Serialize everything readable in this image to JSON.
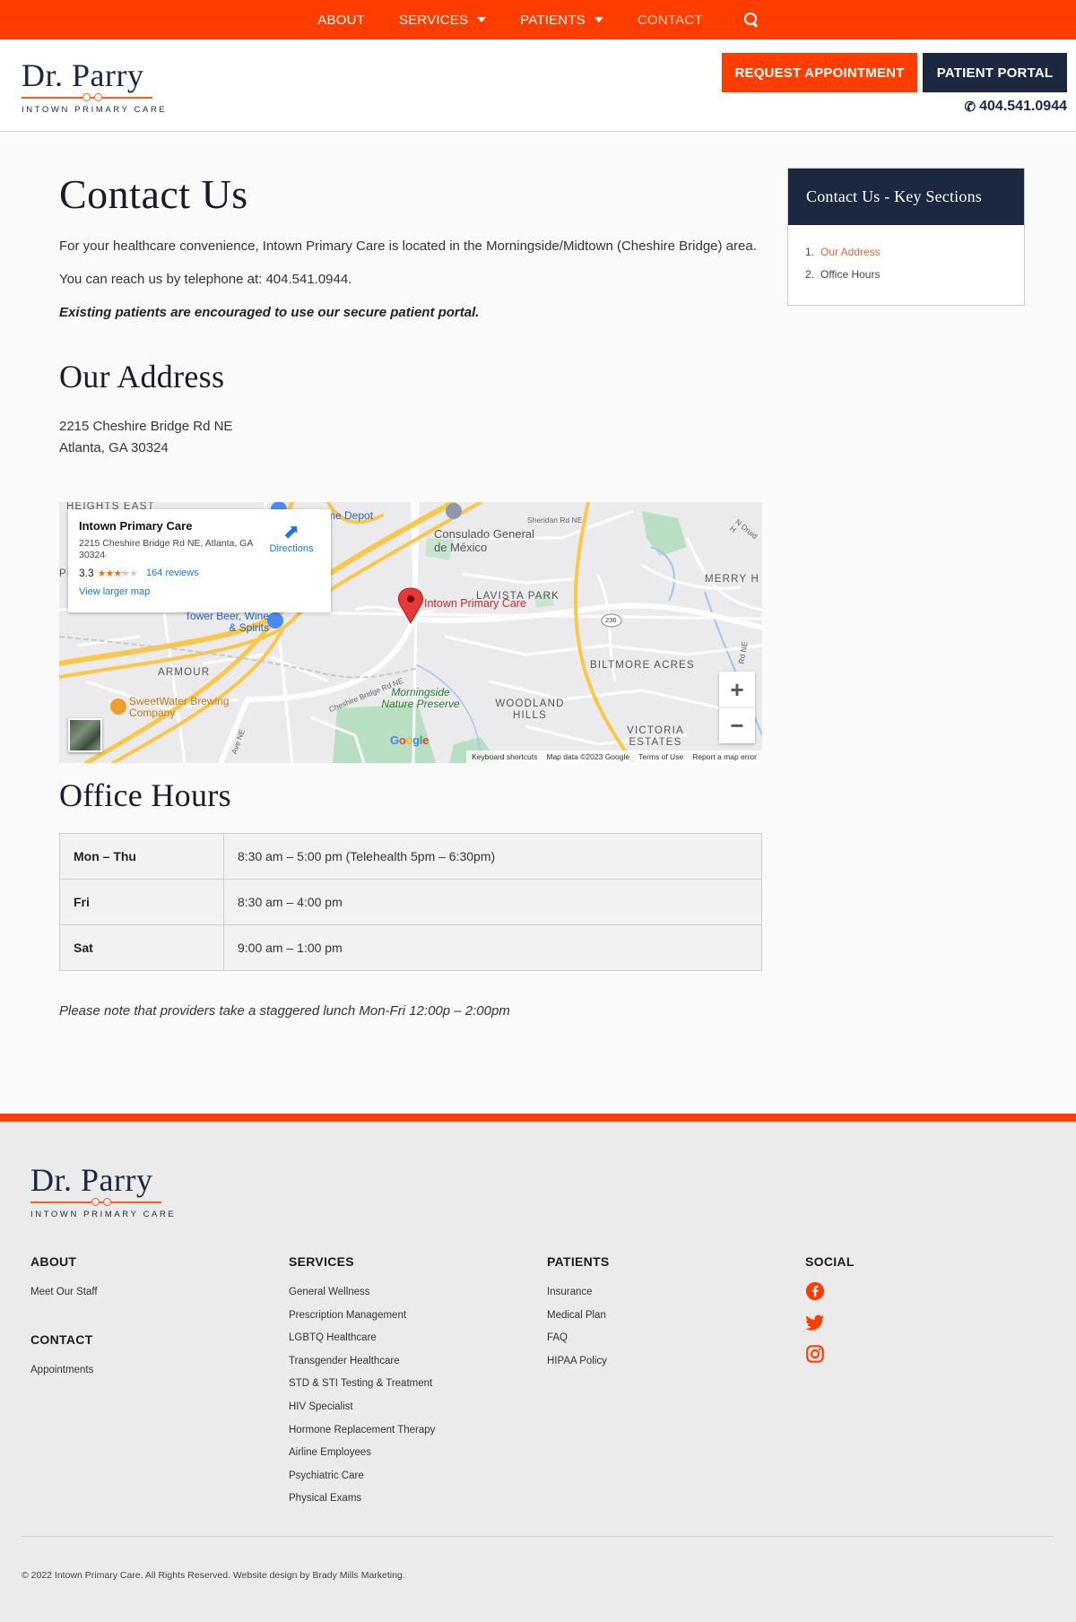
{
  "nav": {
    "items": [
      {
        "label": "ABOUT",
        "dropdown": false,
        "active": false
      },
      {
        "label": "SERVICES",
        "dropdown": true,
        "active": false
      },
      {
        "label": "PATIENTS",
        "dropdown": true,
        "active": false
      },
      {
        "label": "CONTACT",
        "dropdown": false,
        "active": true
      }
    ],
    "search_icon": "search-icon"
  },
  "brand": {
    "name": "Dr. Parry",
    "tagline": "INTOWN PRIMARY CARE",
    "colors": {
      "accent": "#ff3d00",
      "navy": "#1c2840"
    }
  },
  "header": {
    "request_button": "REQUEST APPOINTMENT",
    "portal_button": "PATIENT PORTAL",
    "phone": "404.541.0944"
  },
  "main": {
    "title": "Contact Us",
    "intro": "For your healthcare convenience, Intown Primary Care is located in the Morningside/Midtown (Cheshire Bridge) area.",
    "telephone": "You can reach us by telephone at: 404.541.0944.",
    "portal_note": "Existing patients are encouraged to use our secure patient portal.",
    "address_heading": "Our Address",
    "address_line1": "2215 Cheshire Bridge Rd NE",
    "address_line2": "Atlanta, GA 30324",
    "hours_heading": "Office Hours",
    "hours": [
      {
        "day": "Mon – Thu",
        "time": "8:30 am – 5:00 pm (Telehealth 5pm – 6:30pm)"
      },
      {
        "day": "Fri",
        "time": "8:30 am – 4:00 pm"
      },
      {
        "day": "Sat",
        "time": "9:00 am – 1:00 pm"
      }
    ],
    "lunch_note": "Please note that providers take a staggered lunch Mon-Fri 12:00p – 2:00pm"
  },
  "map": {
    "card_title": "Intown Primary Care",
    "card_address": "2215 Cheshire Bridge Rd NE, Atlanta, GA 30324",
    "rating": "3.3",
    "rating_value": 3.3,
    "reviews": "164 reviews",
    "larger_map": "View larger map",
    "directions": "Directions",
    "pin_label": "Intown Primary Care",
    "labels": {
      "heights_east": "HEIGHTS EAST",
      "home_depot": "me Depot",
      "consulado": "Consulado General de México",
      "sheridan": "Sheridan Rd NE",
      "druid": "N Druid H",
      "merry": "MERRY H",
      "lavista": "LAVISTA PARK",
      "tower_beer": "Tower Beer, Wine & Spirits",
      "route236": "236",
      "biltmore": "BILTMORE ACRES",
      "armour": "ARMOUR",
      "cheshire_road": "Cheshire Bridge Rd NE",
      "morningside": "Morningside Nature Preserve",
      "woodland": "WOODLAND HILLS",
      "victoria": "VICTORIA ESTATES",
      "sweetwater": "SweetWater Brewing Company",
      "pe": "PE",
      "ave": "Ave NE",
      "rd_ne": "Rd NE"
    },
    "google": "Google",
    "footer": [
      "Keyboard shortcuts",
      "Map data ©2023 Google",
      "Terms of Use",
      "Report a map error"
    ]
  },
  "toc": {
    "title": "Contact Us - Key Sections",
    "items": [
      {
        "num": "1.",
        "label": "Our Address"
      },
      {
        "num": "2.",
        "label": "Office Hours"
      }
    ]
  },
  "footer": {
    "about_heading": "ABOUT",
    "about_links": [
      "Meet Our Staff"
    ],
    "contact_heading": "CONTACT",
    "contact_links": [
      "Appointments"
    ],
    "services_heading": "SERVICES",
    "services_links": [
      "General Wellness",
      "Prescription Management",
      "LGBTQ Healthcare",
      "Transgender Healthcare",
      "STD & STI Testing & Treatment",
      "HIV Specialist",
      "Hormone Replacement Therapy",
      "Airline Employees",
      "Psychiatric Care",
      "Physical Exams"
    ],
    "patients_heading": "PATIENTS",
    "patients_links": [
      "Insurance",
      "Medical Plan",
      "FAQ",
      "HIPAA Policy"
    ],
    "social_heading": "SOCIAL",
    "social_icons": [
      "facebook-icon",
      "twitter-icon",
      "instagram-icon"
    ],
    "copyright": "© 2022 Intown Primary Care. All Rights Reserved. Website design by Brady Mills Marketing."
  }
}
